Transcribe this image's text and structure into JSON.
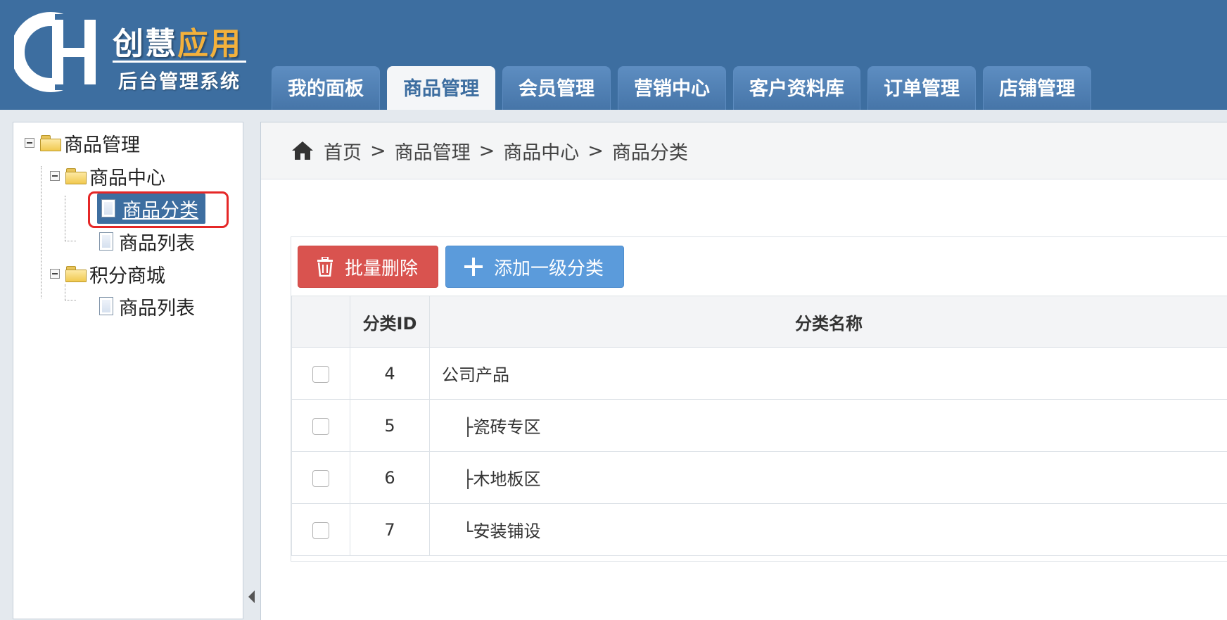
{
  "logo": {
    "title_part1": "创慧",
    "title_part2": "应用",
    "subtitle": "后台管理系统",
    "mark_letters": "CH"
  },
  "nav": {
    "tabs": [
      {
        "label": "我的面板",
        "active": false
      },
      {
        "label": "商品管理",
        "active": true
      },
      {
        "label": "会员管理",
        "active": false
      },
      {
        "label": "营销中心",
        "active": false
      },
      {
        "label": "客户资料库",
        "active": false
      },
      {
        "label": "订单管理",
        "active": false
      },
      {
        "label": "店铺管理",
        "active": false
      }
    ]
  },
  "sidebar": {
    "tree": {
      "root": "商品管理",
      "group1": "商品中心",
      "group1_items": [
        "商品分类",
        "商品列表"
      ],
      "group2": "积分商城",
      "group2_items": [
        "商品列表"
      ]
    },
    "selected": "商品分类"
  },
  "breadcrumb": {
    "items": [
      "首页",
      "商品管理",
      "商品中心",
      "商品分类"
    ],
    "separator": ">"
  },
  "toolbar": {
    "delete_label": "批量删除",
    "add_label": "添加一级分类"
  },
  "table": {
    "headers": {
      "id": "分类ID",
      "name": "分类名称"
    },
    "rows": [
      {
        "id": "4",
        "name": "公司产品",
        "indent": false
      },
      {
        "id": "5",
        "name": "├瓷砖专区",
        "indent": true
      },
      {
        "id": "6",
        "name": "├木地板区",
        "indent": true
      },
      {
        "id": "7",
        "name": "└安装铺设",
        "indent": true
      }
    ]
  },
  "colors": {
    "header_bg": "#3d6ea0",
    "accent_orange": "#f3b13c",
    "danger": "#d9534f",
    "primary": "#5b9bdb",
    "highlight_red": "#e52727"
  },
  "icons": [
    "logo-mark",
    "home-icon",
    "trash-icon",
    "plus-icon",
    "folder-icon",
    "page-icon",
    "collapse-toggle-icon",
    "collapse-arrow-icon"
  ]
}
